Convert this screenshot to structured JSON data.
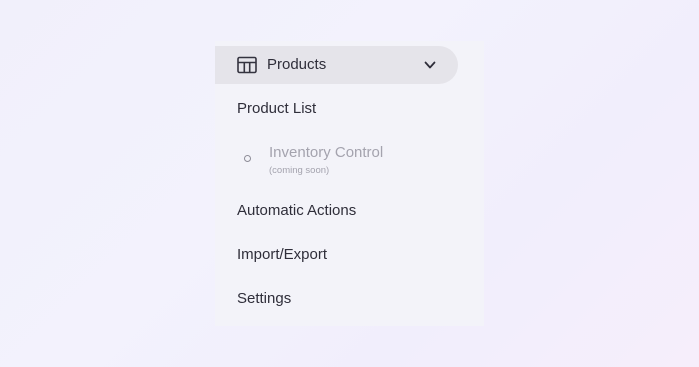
{
  "menu": {
    "group": {
      "label": "Products",
      "icon": "table-icon",
      "expanded": true,
      "toggle_icon": "chevron-down-icon"
    },
    "items": [
      {
        "label": "Product List"
      },
      {
        "label": "Inventory Control",
        "sublabel": "(coming soon)",
        "disabled": true,
        "icon": "circle-icon"
      },
      {
        "label": "Automatic Actions"
      },
      {
        "label": "Import/Export"
      },
      {
        "label": "Settings"
      }
    ]
  },
  "colors": {
    "header_bg": "#e5e4ea",
    "panel_bg": "#f3f3f9",
    "text": "#2f2e3a",
    "disabled_text": "#a4a3ae"
  }
}
